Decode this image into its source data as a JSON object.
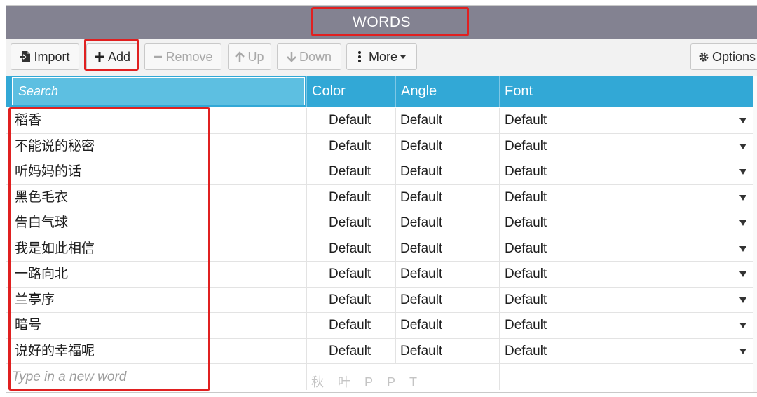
{
  "window": {
    "title": "WORDS"
  },
  "toolbar": {
    "import_label": "Import",
    "add_label": "Add",
    "remove_label": "Remove",
    "up_label": "Up",
    "down_label": "Down",
    "more_label": "More",
    "options_label": "Options"
  },
  "table": {
    "search_placeholder": "Search",
    "columns": {
      "color": "Color",
      "angle": "Angle",
      "font": "Font"
    },
    "rows": [
      {
        "word": "稻香",
        "color": "Default",
        "angle": "Default",
        "font": "Default"
      },
      {
        "word": "不能说的秘密",
        "color": "Default",
        "angle": "Default",
        "font": "Default"
      },
      {
        "word": "听妈妈的话",
        "color": "Default",
        "angle": "Default",
        "font": "Default"
      },
      {
        "word": "黑色毛衣",
        "color": "Default",
        "angle": "Default",
        "font": "Default"
      },
      {
        "word": "告白气球",
        "color": "Default",
        "angle": "Default",
        "font": "Default"
      },
      {
        "word": "我是如此相信",
        "color": "Default",
        "angle": "Default",
        "font": "Default"
      },
      {
        "word": "一路向北",
        "color": "Default",
        "angle": "Default",
        "font": "Default"
      },
      {
        "word": "兰亭序",
        "color": "Default",
        "angle": "Default",
        "font": "Default"
      },
      {
        "word": "暗号",
        "color": "Default",
        "angle": "Default",
        "font": "Default"
      },
      {
        "word": "说好的幸福呢",
        "color": "Default",
        "angle": "Default",
        "font": "Default"
      }
    ],
    "new_word_placeholder": "Type in a new word"
  },
  "watermark": "秋叶PPT",
  "icons": {
    "import": "import-icon",
    "add": "plus-icon",
    "remove": "minus-icon",
    "up": "arrow-up-icon",
    "down": "arrow-down-icon",
    "more": "vertical-ellipsis-icon",
    "options": "gear-icon",
    "dropdown": "chevron-down-icon"
  },
  "colors": {
    "titlebar": "#838291",
    "header": "#32a8d6",
    "search_bg": "#5dbfe1",
    "highlight": "#e02020"
  }
}
